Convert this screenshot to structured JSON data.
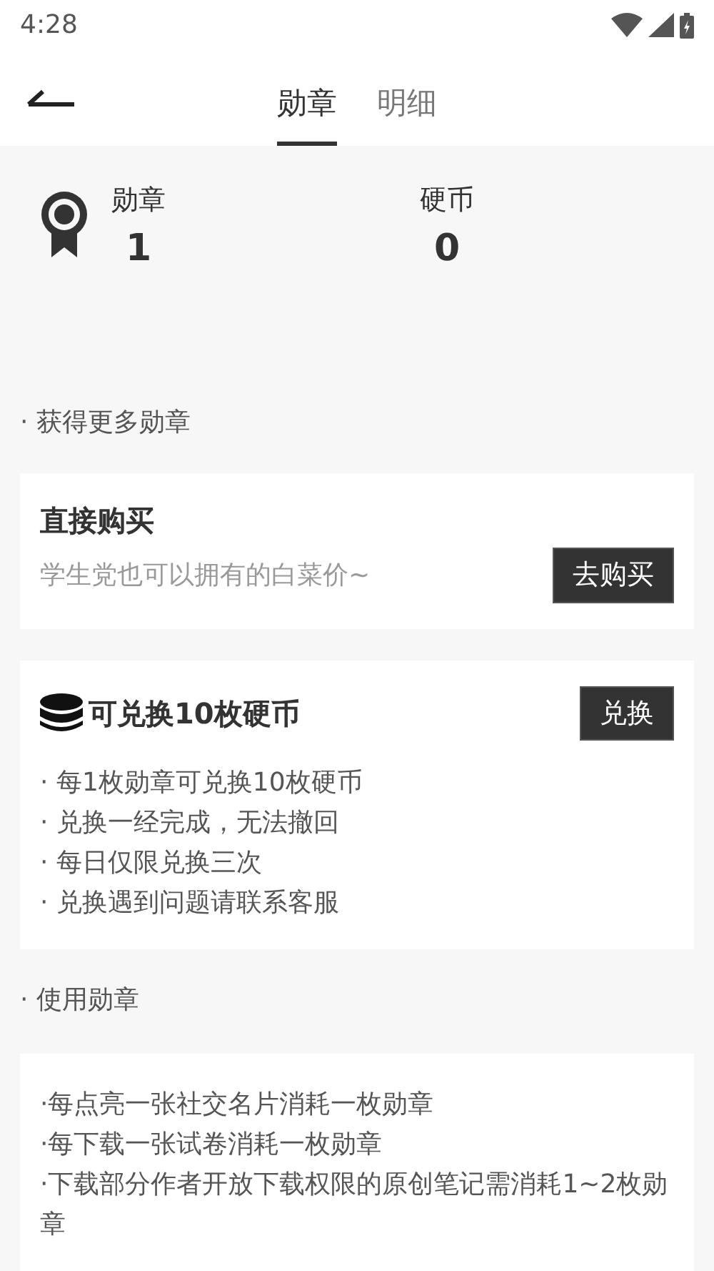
{
  "status_bar": {
    "time": "4:28"
  },
  "tabs": [
    {
      "label": "勋章",
      "selected": true
    },
    {
      "label": "明细",
      "selected": false
    }
  ],
  "stats": [
    {
      "kind": "medal",
      "label": "勋章",
      "value": "1"
    },
    {
      "kind": "coin",
      "label": "硬币",
      "value": "0"
    }
  ],
  "sections": [
    {
      "heading": "· 获得更多勋章",
      "cards": [
        {
          "kind": "buy",
          "title": "直接购买",
          "subtitle": "学生党也可以拥有的白菜价~",
          "button": "去购买"
        },
        {
          "kind": "exchange",
          "title": "可兑换10枚硬币",
          "button": "兑换",
          "lines": [
            "· 每1枚勋章可兑换10枚硬币",
            "· 兑换一经完成，无法撤回",
            "· 每日仅限兑换三次",
            "· 兑换遇到问题请联系客服"
          ]
        }
      ]
    },
    {
      "heading": "· 使用勋章",
      "cards": [
        {
          "kind": "info",
          "lines": [
            "·每点亮一张社交名片消耗一枚勋章",
            "·每下载一张试卷消耗一枚勋章",
            "·下载部分作者开放下载权限的原创笔记需消耗1~2枚勋章"
          ]
        }
      ]
    }
  ]
}
